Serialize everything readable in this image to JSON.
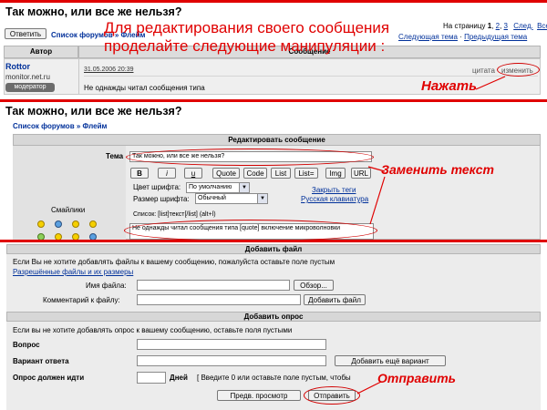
{
  "colors": {
    "accent_red": "#e00000",
    "link_blue": "#00309a",
    "panel_gray": "#ececec"
  },
  "section1": {
    "title": "Так можно, или все же нельзя?",
    "overlay_line1": "Для редактирования своего сообщения",
    "overlay_line2": "проделайте следующие манипуляции :",
    "reply_button": "Ответить",
    "breadcrumb_forums": "Список форумов",
    "breadcrumb_sep": " » ",
    "breadcrumb_flame": "Флейм",
    "page_label": "На страницу",
    "page_current": "1",
    "page_2": "2",
    "page_3": "3",
    "next": "След.",
    "all": "Все",
    "next_topic": "Следующая тема",
    "prev_topic": "Предыдущая тема",
    "col_author": "Автор",
    "col_message": "Сообщение",
    "author_name": "Rottor",
    "author_site": "monitor.net.ru",
    "author_rank": "модератор",
    "post_date": "31.05.2006 20:39",
    "quote_link": "цитата",
    "edit_link": "изменить",
    "post_text": "Не однажды читал сообщения типа",
    "annotation_press": "Нажать"
  },
  "section2": {
    "title": "Так можно, или все же нельзя?",
    "breadcrumb_forums": "Список форумов",
    "breadcrumb_sep": " » ",
    "breadcrumb_flame": "Флейм",
    "header": "Редактировать сообщение",
    "topic_label": "Тема",
    "topic_value": "Так можно, или все же нельзя?",
    "format_buttons": [
      "B",
      "i",
      "u",
      "Quote",
      "Code",
      "List",
      "List=",
      "Img",
      "URL"
    ],
    "font_color_label": "Цвет шрифта:",
    "font_color_value": "По умолчанию",
    "font_size_label": "Размер шрифта:",
    "font_size_value": "Обычный",
    "close_tags": "Закрыть теги",
    "russian_keyboard": "Русская клавиатура",
    "list_hint": "Список: [list]текст[/list] (alt+l)",
    "smilies_label": "Смайлики",
    "message_text": "Не однажды читал сообщения типа [quote] включение микроволновки",
    "annotation_replace": "Заменить текст"
  },
  "section3": {
    "attach_header": "Добавить файл",
    "attach_info": "Если Вы не хотите добавлять файлы к вашему сообщению, пожалуйста оставьте поле пустым",
    "allowed_files_link": "Разрешённые файлы и их размеры",
    "file_name_label": "Имя файла:",
    "browse_button": "Обзор...",
    "file_comment_label": "Комментарий к файлу:",
    "add_file_button": "Добавить файл",
    "poll_header": "Добавить опрос",
    "poll_info": "Если вы не хотите добавлять опрос к вашему сообщению, оставьте поля пустыми",
    "question_label": "Вопрос",
    "answer_label": "Вариант ответа",
    "add_option_button": "Добавить ещё вариант",
    "poll_duration_label": "Опрос должен идти",
    "days_label": "Дней",
    "days_hint": "[ Введите 0 или оставьте поле пустым, чтобы",
    "preview_button": "Предв. просмотр",
    "submit_button": "Отправить",
    "annotation_send": "Отправить"
  }
}
